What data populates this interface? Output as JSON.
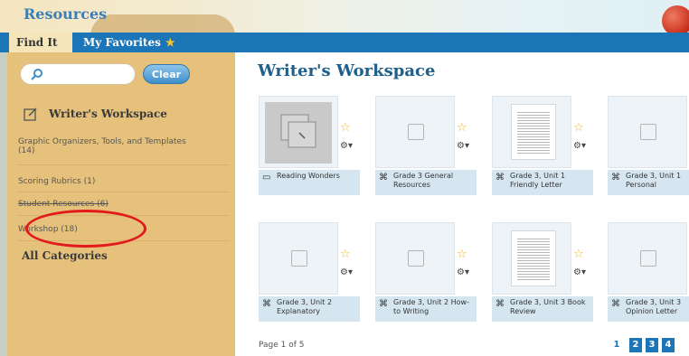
{
  "app": {
    "title": "Resources"
  },
  "tabs": [
    {
      "label": "Find It",
      "active": true
    },
    {
      "label": "My Favorites",
      "active": false
    }
  ],
  "sidebar": {
    "search": {
      "value": "",
      "placeholder": ""
    },
    "clear_label": "Clear",
    "section_title": "Writer's Workspace",
    "items": [
      {
        "label": "Graphic Organizers, Tools, and Templates",
        "count": "(14)"
      },
      {
        "label": "Scoring Rubrics (1)"
      },
      {
        "label": "Student Resources (6)"
      },
      {
        "label": "Workshop (18)"
      }
    ],
    "all_categories": "All Categories"
  },
  "main": {
    "title": "Writer's Workspace",
    "cards": [
      {
        "label": "Reading Wonders",
        "type": "image"
      },
      {
        "label": "Grade 3 General Resources",
        "type": "doc"
      },
      {
        "label": "Grade 3, Unit 1 Friendly Letter",
        "type": "page"
      },
      {
        "label": "Grade 3, Unit 1 Personal",
        "type": "doc"
      },
      {
        "label": "Grade 3, Unit 2 Explanatory",
        "type": "doc"
      },
      {
        "label": "Grade 3, Unit 2 How-to Writing",
        "type": "doc"
      },
      {
        "label": "Grade 3, Unit 3 Book Review",
        "type": "page"
      },
      {
        "label": "Grade 3, Unit 3 Opinion Letter",
        "type": "doc"
      }
    ],
    "pagination": {
      "info": "Page 1 of 5",
      "current": "1",
      "pages": [
        "2",
        "3",
        "4"
      ]
    }
  },
  "colors": {
    "accent": "#1b75b7",
    "sidebar": "#e6c17b",
    "highlight": "#e11b1b"
  }
}
